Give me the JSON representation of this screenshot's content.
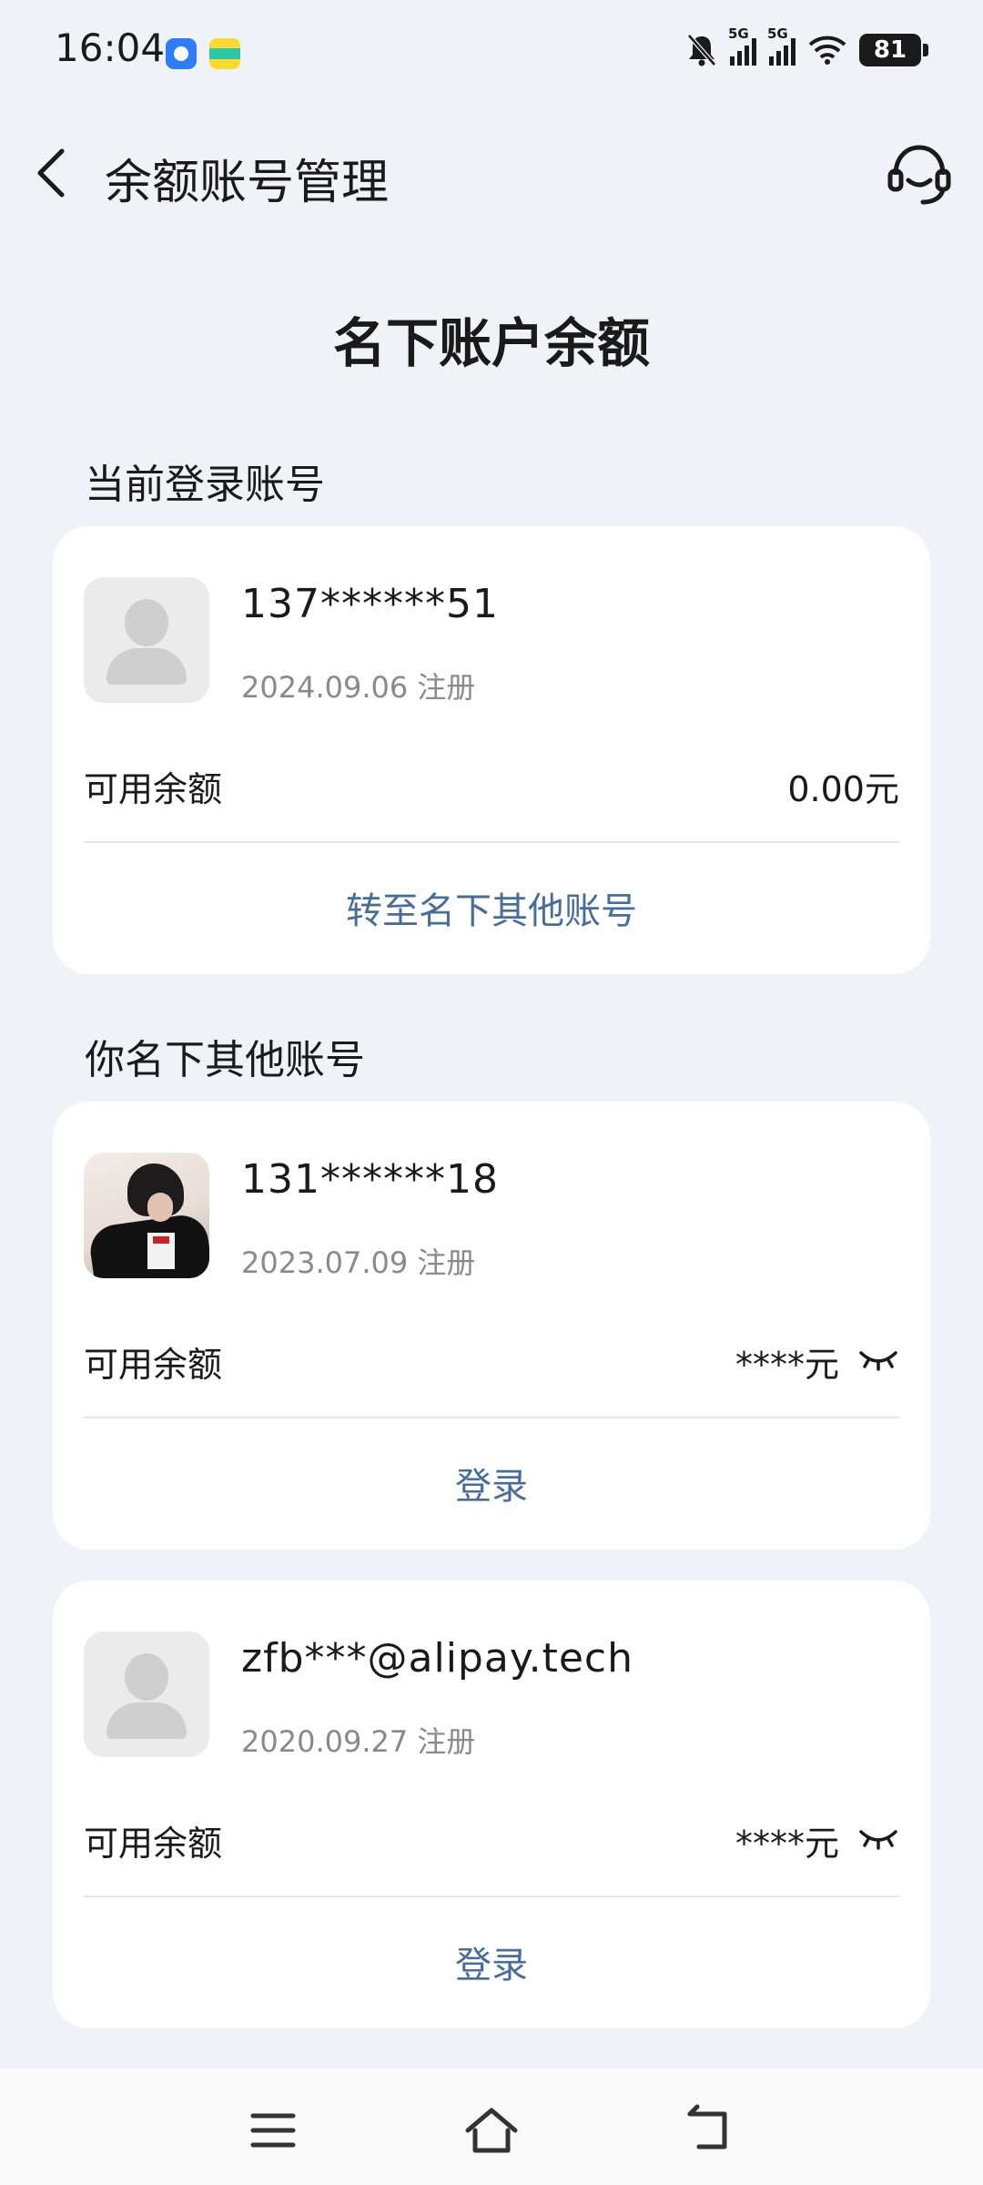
{
  "status_bar": {
    "time": "16:04",
    "network_1": "5G",
    "network_2": "5G",
    "battery": "81",
    "icons": [
      "app-icon-blue",
      "app-icon-yellow",
      "mute-bell-icon",
      "signal-icon",
      "signal-icon",
      "wifi-icon",
      "battery-icon"
    ]
  },
  "header": {
    "title": "余额账号管理",
    "back_icon": "chevron-left-icon",
    "service_icon": "customer-service-headset-icon"
  },
  "main_title": "名下账户余额",
  "current_section": {
    "label": "当前登录账号",
    "account": {
      "name": "137******51",
      "registered": "2024.09.06 注册",
      "balance_label": "可用余额",
      "balance_value": "0.00元",
      "action": "转至名下其他账号"
    }
  },
  "other_section": {
    "label": "你名下其他账号",
    "accounts": [
      {
        "name": "131******18",
        "registered": "2023.07.09 注册",
        "balance_label": "可用余额",
        "balance_value": "****元",
        "action": "登录",
        "avatar": "photo"
      },
      {
        "name": "zfb***@alipay.tech",
        "registered": "2020.09.27 注册",
        "balance_label": "可用余额",
        "balance_value": "****元",
        "action": "登录",
        "avatar": "default-user"
      }
    ]
  },
  "nav_bar": {
    "icons": [
      "menu-icon",
      "home-icon",
      "back-icon"
    ]
  },
  "colors": {
    "background": "#eff2f7",
    "card": "#ffffff",
    "link": "#4a6d96",
    "muted_text": "#8a8a8a"
  }
}
